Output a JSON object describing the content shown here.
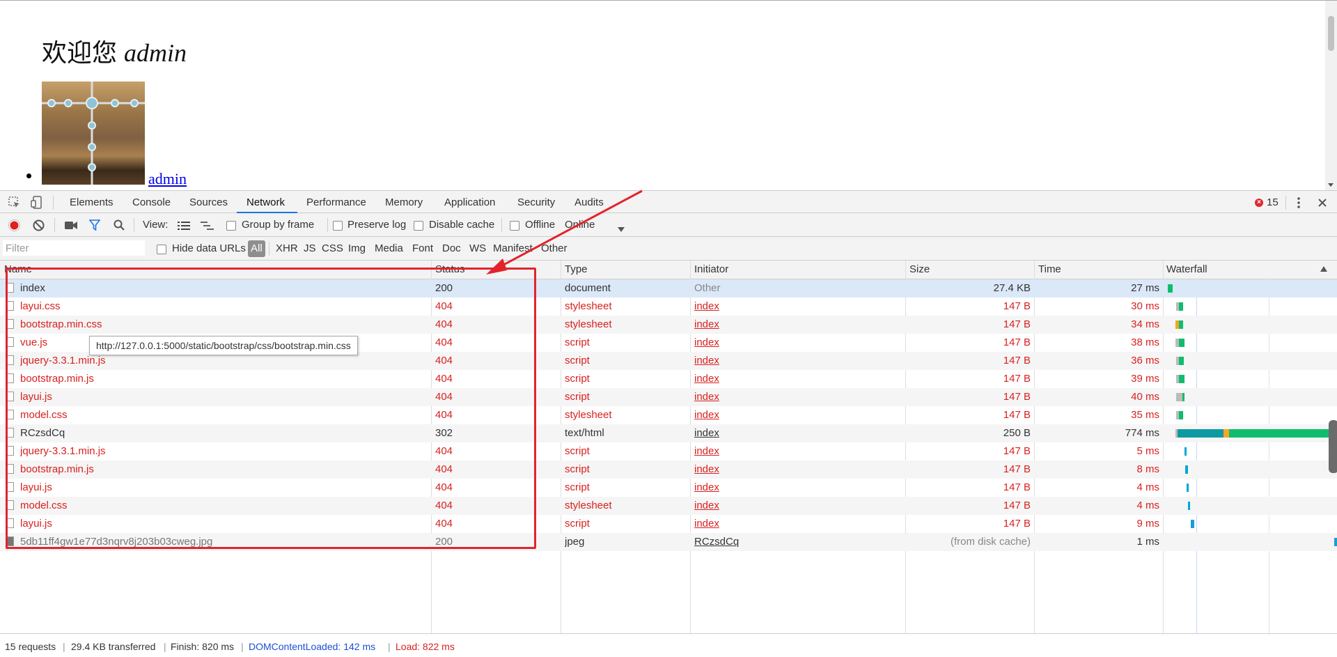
{
  "page": {
    "welcome_text": "欢迎您",
    "username": "admin",
    "link_text": "admin"
  },
  "devtools": {
    "tabs": [
      "Elements",
      "Console",
      "Sources",
      "Network",
      "Performance",
      "Memory",
      "Application",
      "Security",
      "Audits"
    ],
    "active_tab": "Network",
    "error_count": "15",
    "toolbar": {
      "view_label": "View:",
      "group_by_frame": "Group by frame",
      "preserve_log": "Preserve log",
      "disable_cache": "Disable cache",
      "offline": "Offline",
      "throttle_value": "Online"
    },
    "filter": {
      "placeholder": "Filter",
      "hide_data_urls": "Hide data URLs",
      "types": [
        "All",
        "XHR",
        "JS",
        "CSS",
        "Img",
        "Media",
        "Font",
        "Doc",
        "WS",
        "Manifest",
        "Other"
      ]
    },
    "columns": {
      "name": "Name",
      "status": "Status",
      "type": "Type",
      "initiator": "Initiator",
      "size": "Size",
      "time": "Time",
      "waterfall": "Waterfall"
    },
    "rows": [
      {
        "name": "index",
        "status": "200",
        "type": "document",
        "initiator": "Other",
        "size": "27.4 KB",
        "time": "27 ms"
      },
      {
        "name": "layui.css",
        "status": "404",
        "type": "stylesheet",
        "initiator": "index",
        "size": "147 B",
        "time": "30 ms"
      },
      {
        "name": "bootstrap.min.css",
        "status": "404",
        "type": "stylesheet",
        "initiator": "index",
        "size": "147 B",
        "time": "34 ms"
      },
      {
        "name": "vue.js",
        "status": "404",
        "type": "script",
        "initiator": "index",
        "size": "147 B",
        "time": "38 ms"
      },
      {
        "name": "jquery-3.3.1.min.js",
        "status": "404",
        "type": "script",
        "initiator": "index",
        "size": "147 B",
        "time": "36 ms"
      },
      {
        "name": "bootstrap.min.js",
        "status": "404",
        "type": "script",
        "initiator": "index",
        "size": "147 B",
        "time": "39 ms"
      },
      {
        "name": "layui.js",
        "status": "404",
        "type": "script",
        "initiator": "index",
        "size": "147 B",
        "time": "40 ms"
      },
      {
        "name": "model.css",
        "status": "404",
        "type": "stylesheet",
        "initiator": "index",
        "size": "147 B",
        "time": "35 ms"
      },
      {
        "name": "RCzsdCq",
        "status": "302",
        "type": "text/html",
        "initiator": "index",
        "size": "250 B",
        "time": "774 ms"
      },
      {
        "name": "jquery-3.3.1.min.js",
        "status": "404",
        "type": "script",
        "initiator": "index",
        "size": "147 B",
        "time": "5 ms"
      },
      {
        "name": "bootstrap.min.js",
        "status": "404",
        "type": "script",
        "initiator": "index",
        "size": "147 B",
        "time": "8 ms"
      },
      {
        "name": "layui.js",
        "status": "404",
        "type": "script",
        "initiator": "index",
        "size": "147 B",
        "time": "4 ms"
      },
      {
        "name": "model.css",
        "status": "404",
        "type": "stylesheet",
        "initiator": "index",
        "size": "147 B",
        "time": "4 ms"
      },
      {
        "name": "layui.js",
        "status": "404",
        "type": "script",
        "initiator": "index",
        "size": "147 B",
        "time": "9 ms"
      },
      {
        "name": "5db11ff4gw1e77d3nqrv8j203b03cweg.jpg",
        "status": "200",
        "type": "jpeg",
        "initiator": "RCzsdCq",
        "size": "(from disk cache)",
        "time": "1 ms"
      }
    ],
    "tooltip": "http://127.0.0.1:5000/static/bootstrap/css/bootstrap.min.css",
    "status": {
      "requests": "15 requests",
      "transferred": "29.4 KB transferred",
      "finish": "Finish: 820 ms",
      "dcl": "DOMContentLoaded: 142 ms",
      "load": "Load: 822 ms"
    }
  },
  "colors": {
    "error_red": "#d8211f",
    "accent_blue": "#1a73e8",
    "annotation_red": "#e3232b",
    "waterfall_green": "#0fbd6c",
    "waterfall_teal": "#0d9aa3",
    "waterfall_orange": "#f5a623"
  }
}
